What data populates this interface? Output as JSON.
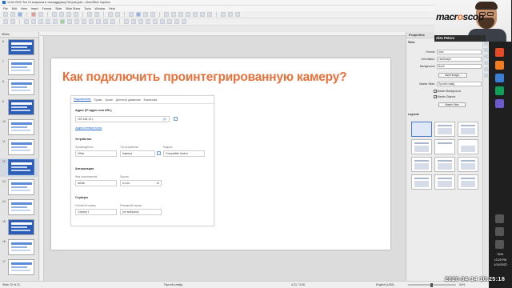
{
  "window": {
    "title": "14.04.2020 Топ 10 вопросов в техподдержку Петров.pptx - LibreOffice Impress",
    "min_glyph": "—",
    "max_glyph": "❐",
    "close_glyph": "✕"
  },
  "menu": [
    "File",
    "Edit",
    "View",
    "Insert",
    "Format",
    "Slide",
    "Slide Show",
    "Tools",
    "Window",
    "Help"
  ],
  "slides_panel": {
    "header": "Slides",
    "numbers": [
      "6",
      "7",
      "8",
      "9",
      "10",
      "11",
      "12",
      "13",
      "14",
      "15",
      "16",
      "17"
    ],
    "selected_index": 6
  },
  "slide": {
    "title": "Как подключить проинтегрированную камеру?",
    "dialog": {
      "tabs": [
        "Подключение",
        "Права",
        "Архив",
        "Детектор движения",
        "Аналитика"
      ],
      "address_label": "Адрес (IP-адрес или URL)",
      "address_value": "192.168.10.1",
      "address_hint": "(h)",
      "link": "Задать сетевые порты",
      "device_section": "Устройство",
      "vendor_label": "Производитель",
      "vendor_value": "Other",
      "type_label": "Тип устройства",
      "type_value": "Камера",
      "model_label": "Модель",
      "model_value": "Compatible device",
      "auth_section": "Авторизация",
      "user_label": "Имя пользователя",
      "user_value": "admin",
      "pass_label": "Пароль",
      "pass_value": "••••••••",
      "pass_suffix": "10",
      "servers_section": "Серверы",
      "main_label": "Основной сервер",
      "main_value": "Сервер 1",
      "spare_label": "Резервный сервер",
      "spare_value": "(не выбрано)"
    }
  },
  "properties": {
    "header": "Properties",
    "section_slide": "Slide",
    "format_label": "Format:",
    "format_value": "User",
    "orientation_label": "Orientation:",
    "orientation_value": "Landscape",
    "background_label": "Background:",
    "background_value": "None",
    "insert_image": "Insert Image...",
    "master_slide_label": "Master Slide:",
    "master_slide_value": "Пустой слайд",
    "master_background": "Master Background",
    "master_objects": "Master Objects",
    "master_view": "Master View",
    "section_layouts": "Layouts"
  },
  "webcam": {
    "logo_a": "macr",
    "logo_b": "o",
    "logo_c": "scop",
    "name": "Alex Petrov"
  },
  "status": {
    "slide_of": "Slide 12 of 21",
    "layout_name": "Пустой слайд",
    "coords": "4.21 / 3.00",
    "size": "0.00 x 0.00",
    "language": "English (USA)",
    "zoom": "54%"
  },
  "taskbar": {
    "lang": "ENG",
    "time": "10:25 PM",
    "date": "4/14/2020"
  },
  "stamp": "2020-04-14  10:25:18"
}
